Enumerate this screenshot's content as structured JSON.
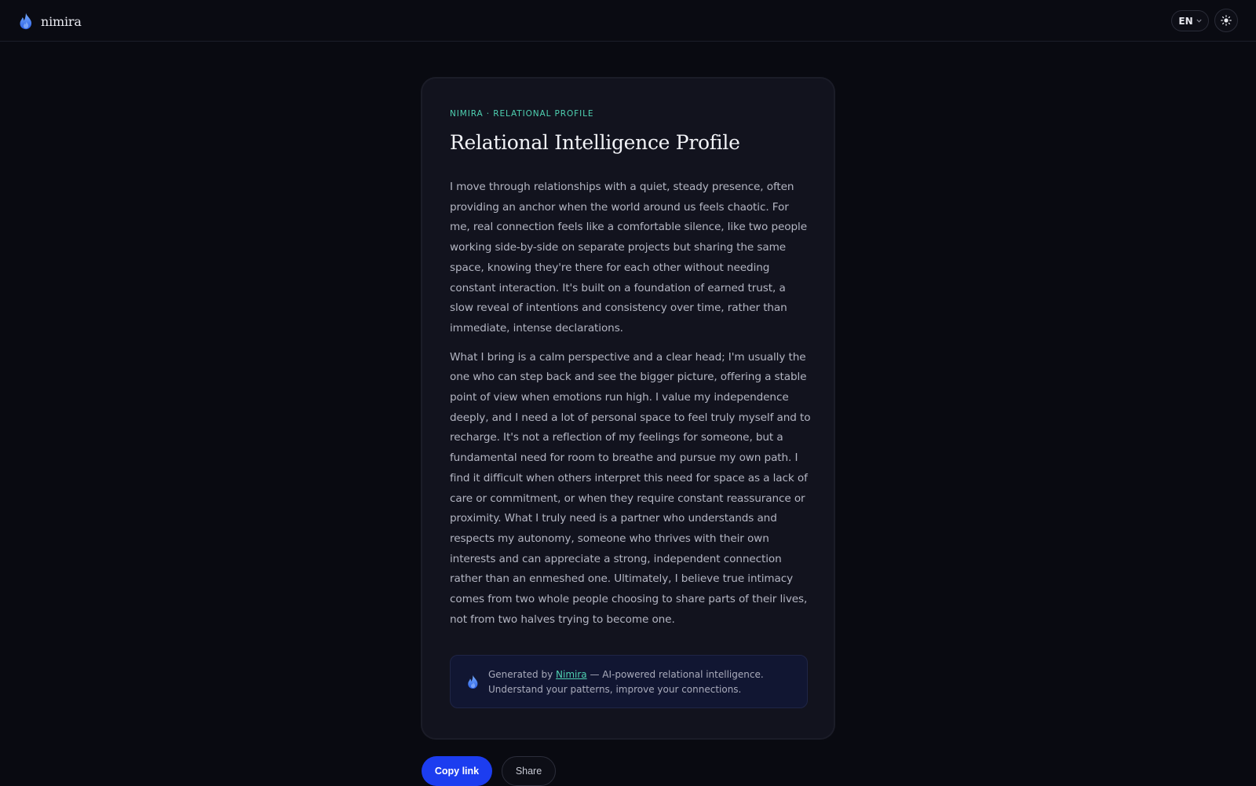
{
  "header": {
    "brand_name": "nimira",
    "language_label": "EN",
    "icons": {
      "logo": "flame-icon",
      "language_dropdown": "chevron-down-icon",
      "theme_toggle": "sun-icon"
    }
  },
  "profile": {
    "eyebrow": "NIMIRA · RELATIONAL PROFILE",
    "title": "Relational Intelligence Profile",
    "paragraphs": [
      "I move through relationships with a quiet, steady presence, often providing an anchor when the world around us feels chaotic. For me, real connection feels like a comfortable silence, like two people working side-by-side on separate projects but sharing the same space, knowing they're there for each other without needing constant interaction. It's built on a foundation of earned trust, a slow reveal of intentions and consistency over time, rather than immediate, intense declarations.",
      "What I bring is a calm perspective and a clear head; I'm usually the one who can step back and see the bigger picture, offering a stable point of view when emotions run high. I value my independence deeply, and I need a lot of personal space to feel truly myself and to recharge. It's not a reflection of my feelings for someone, but a fundamental need for room to breathe and pursue my own path. I find it difficult when others interpret this need for space as a lack of care or commitment, or when they require constant reassurance or proximity. What I truly need is a partner who understands and respects my autonomy, someone who thrives with their own interests and can appreciate a strong, independent connection rather than an enmeshed one. Ultimately, I believe true intimacy comes from two whole people choosing to share parts of their lives, not from two halves trying to become one."
    ],
    "generated_by": {
      "prefix": "Generated by ",
      "link_text": "Nimira",
      "suffix": " — AI-powered relational intelligence.",
      "line2": "Understand your patterns, improve your connections."
    }
  },
  "actions": {
    "copy_link": "Copy link",
    "share": "Share"
  },
  "colors": {
    "background": "#090a11",
    "card": "#12131e",
    "accent_teal": "#4fd1b2",
    "primary_button": "#1c3df0",
    "flame_gradient_top": "#6fa8ff",
    "flame_gradient_bottom": "#2a63e8"
  }
}
